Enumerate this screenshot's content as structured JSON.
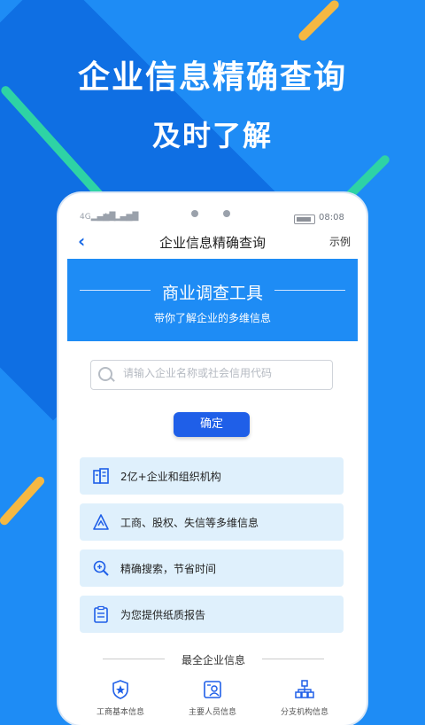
{
  "hero": {
    "title": "企业信息精确查询",
    "subtitle": "及时了解"
  },
  "status_bar": {
    "signal_1": "4G",
    "signal_2": "4G",
    "time": "08:08"
  },
  "navbar": {
    "title": "企业信息精确查询",
    "right_label": "示例"
  },
  "banner": {
    "title": "商业调查工具",
    "subtitle": "带你了解企业的多维信息"
  },
  "search": {
    "placeholder": "请输入企业名称或社会信用代码"
  },
  "confirm_label": "确定",
  "features": [
    {
      "label": "2亿+企业和组织机构",
      "icon": "building-icon"
    },
    {
      "label": "工商、股权、失信等多维信息",
      "icon": "warning-triangle-icon"
    },
    {
      "label": "精确搜索，节省时间",
      "icon": "magnifier-icon"
    },
    {
      "label": "为您提供纸质报告",
      "icon": "clipboard-icon"
    }
  ],
  "section_title": "最全企业信息",
  "bottom_items": [
    {
      "label": "工商基本信息",
      "icon": "police-badge-icon"
    },
    {
      "label": "主要人员信息",
      "icon": "person-card-icon"
    },
    {
      "label": "分支机构信息",
      "icon": "org-chart-icon"
    }
  ],
  "colors": {
    "background": "#1e8cf5",
    "accent": "#1f5fe8",
    "feature_bg": "#dff0fc",
    "stripe_green": "#2ed3a5",
    "stripe_yellow": "#f5b843"
  }
}
